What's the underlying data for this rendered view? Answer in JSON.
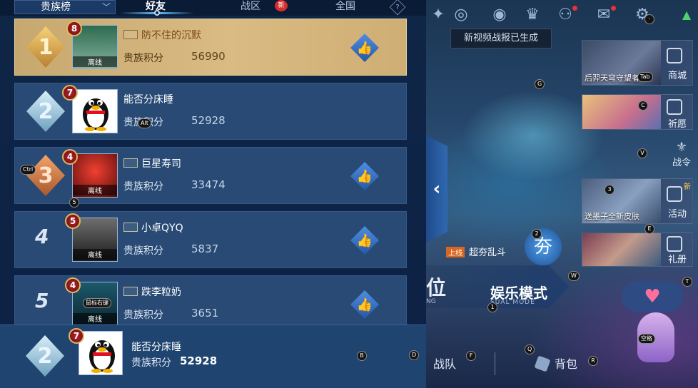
{
  "tabs": {
    "dropdown_label": "贵族榜",
    "friends": "好友",
    "zone": "战区",
    "zone_new_badge": "新",
    "all": "全国",
    "help": "?"
  },
  "score_label": "贵族积分",
  "offline_label": "离线",
  "rows": [
    {
      "rank": "1",
      "level": "8",
      "name": "防不住的沉默",
      "score": "56990",
      "offline": true
    },
    {
      "rank": "2",
      "level": "7",
      "name": "能否分床睡",
      "score": "52928",
      "offline": false
    },
    {
      "rank": "3",
      "level": "4",
      "name": "巨星寿司",
      "score": "33474",
      "offline": true
    },
    {
      "rank": "4",
      "level": "5",
      "name": "小卓QYQ",
      "score": "5837",
      "offline": true
    },
    {
      "rank": "5",
      "level": "4",
      "name": "跌李粒奶",
      "score": "3651",
      "offline": true
    }
  ],
  "self": {
    "rank": "2",
    "level": "7",
    "name": "能否分床睡",
    "score": "52928"
  },
  "game": {
    "toast": "新视频战报已生成",
    "cards": [
      {
        "caption": "后羿天穹守望者",
        "label": "商城"
      },
      {
        "caption": "",
        "label": "祈愿"
      },
      {
        "caption": "送墨子全新皮肤",
        "label": "活动"
      },
      {
        "caption": "",
        "label": "礼册"
      }
    ],
    "war_order": "战令",
    "activity_new": "新",
    "event_tag": "上线",
    "event_name": "超夯乱斗",
    "event_badge": "夯",
    "left_mode_word": "位",
    "left_mode_sub": "NG",
    "mode_title": "娱乐模式",
    "mode_sub": "SUAL MODE",
    "squad": "战队",
    "backpack": "背包"
  },
  "keys": {
    "tab": "Tab",
    "alt": "Alt",
    "ctrl": "Ctrl",
    "mouse_right": "鼠标右键",
    "space": "空格",
    "g": "G",
    "c": "C",
    "v": "V",
    "n3": "3",
    "e": "E",
    "n2": "2",
    "w": "W",
    "t": "T",
    "n1": "1",
    "n5": "5",
    "b": "B",
    "d": "D",
    "f": "F",
    "q": "Q",
    "r": "R",
    "dot": "·"
  }
}
